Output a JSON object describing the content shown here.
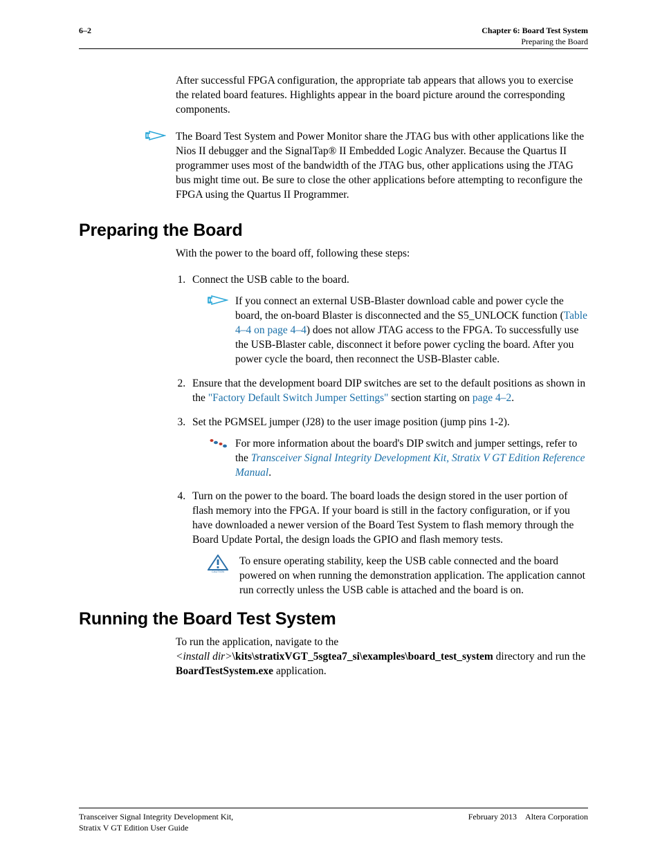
{
  "header": {
    "page_number": "6–2",
    "chapter_line": "Chapter 6: Board Test System",
    "sub_line": "Preparing the Board"
  },
  "intro": {
    "p1": "After successful FPGA configuration, the appropriate tab appears that allows you to exercise the related board features. Highlights appear in the board picture around the corresponding components.",
    "note1": "The Board Test System and Power Monitor share the JTAG bus with other applications like the Nios II debugger and the SignalTap® II Embedded Logic Analyzer. Because the Quartus II programmer uses most of the bandwidth of the JTAG bus, other applications using the JTAG bus might time out. Be sure to close the other applications before attempting to reconfigure the FPGA using the Quartus II Programmer."
  },
  "sections": {
    "preparing": {
      "title": "Preparing the Board",
      "lead": "With the power to the board off, following these steps:",
      "step1": "Connect the USB cable to the board.",
      "step1_note_a": "If you connect an external USB-Blaster download cable and power cycle the board, the on-board Blaster is disconnected and the S5_UNLOCK function (",
      "step1_note_link": "Table 4–4 on page 4–4",
      "step1_note_b": ") does not allow JTAG access to the FPGA. To successfully use the USB-Blaster cable, disconnect it before power cycling the board. After you power cycle the board, then reconnect the USB-Blaster cable.",
      "step2_a": "Ensure that the development board DIP switches are set to the default positions as shown in the ",
      "step2_link1": "\"Factory Default Switch Jumper Settings\"",
      "step2_b": " section starting on ",
      "step2_link2": "page 4–2",
      "step2_c": ".",
      "step3": "Set the PGMSEL jumper (J28) to the user image position (jump pins 1-2).",
      "step3_note_a": "For more information about the board's DIP switch and jumper settings, refer to the ",
      "step3_note_link": "Transceiver Signal Integrity Development Kit, Stratix V GT Edition Reference Manual",
      "step3_note_b": ".",
      "step4": "Turn on the power to the board. The board loads the design stored in the user portion of flash memory into the FPGA. If your board is still in the factory configuration, or if you have downloaded a newer version of the Board Test System to flash memory through the Board Update Portal, the design loads the GPIO and flash memory tests.",
      "caution": "To ensure operating stability, keep the USB cable connected and the board powered on when running the demonstration application. The application cannot run correctly unless the USB cable is attached and the board is on."
    },
    "running": {
      "title": "Running the Board Test System",
      "p_a": "To run the application, navigate to the ",
      "p_inst": "<install dir>",
      "p_path": "\\kits\\stratixVGT_5sgtea7_si\\examples\\board_test_system",
      "p_b": " directory and run the ",
      "p_exe": "BoardTestSystem.exe",
      "p_c": " application."
    }
  },
  "footer": {
    "left_l1": "Transceiver Signal Integrity Development Kit,",
    "left_l2": "Stratix V GT Edition User Guide",
    "right": "February 2013 Altera Corporation"
  }
}
